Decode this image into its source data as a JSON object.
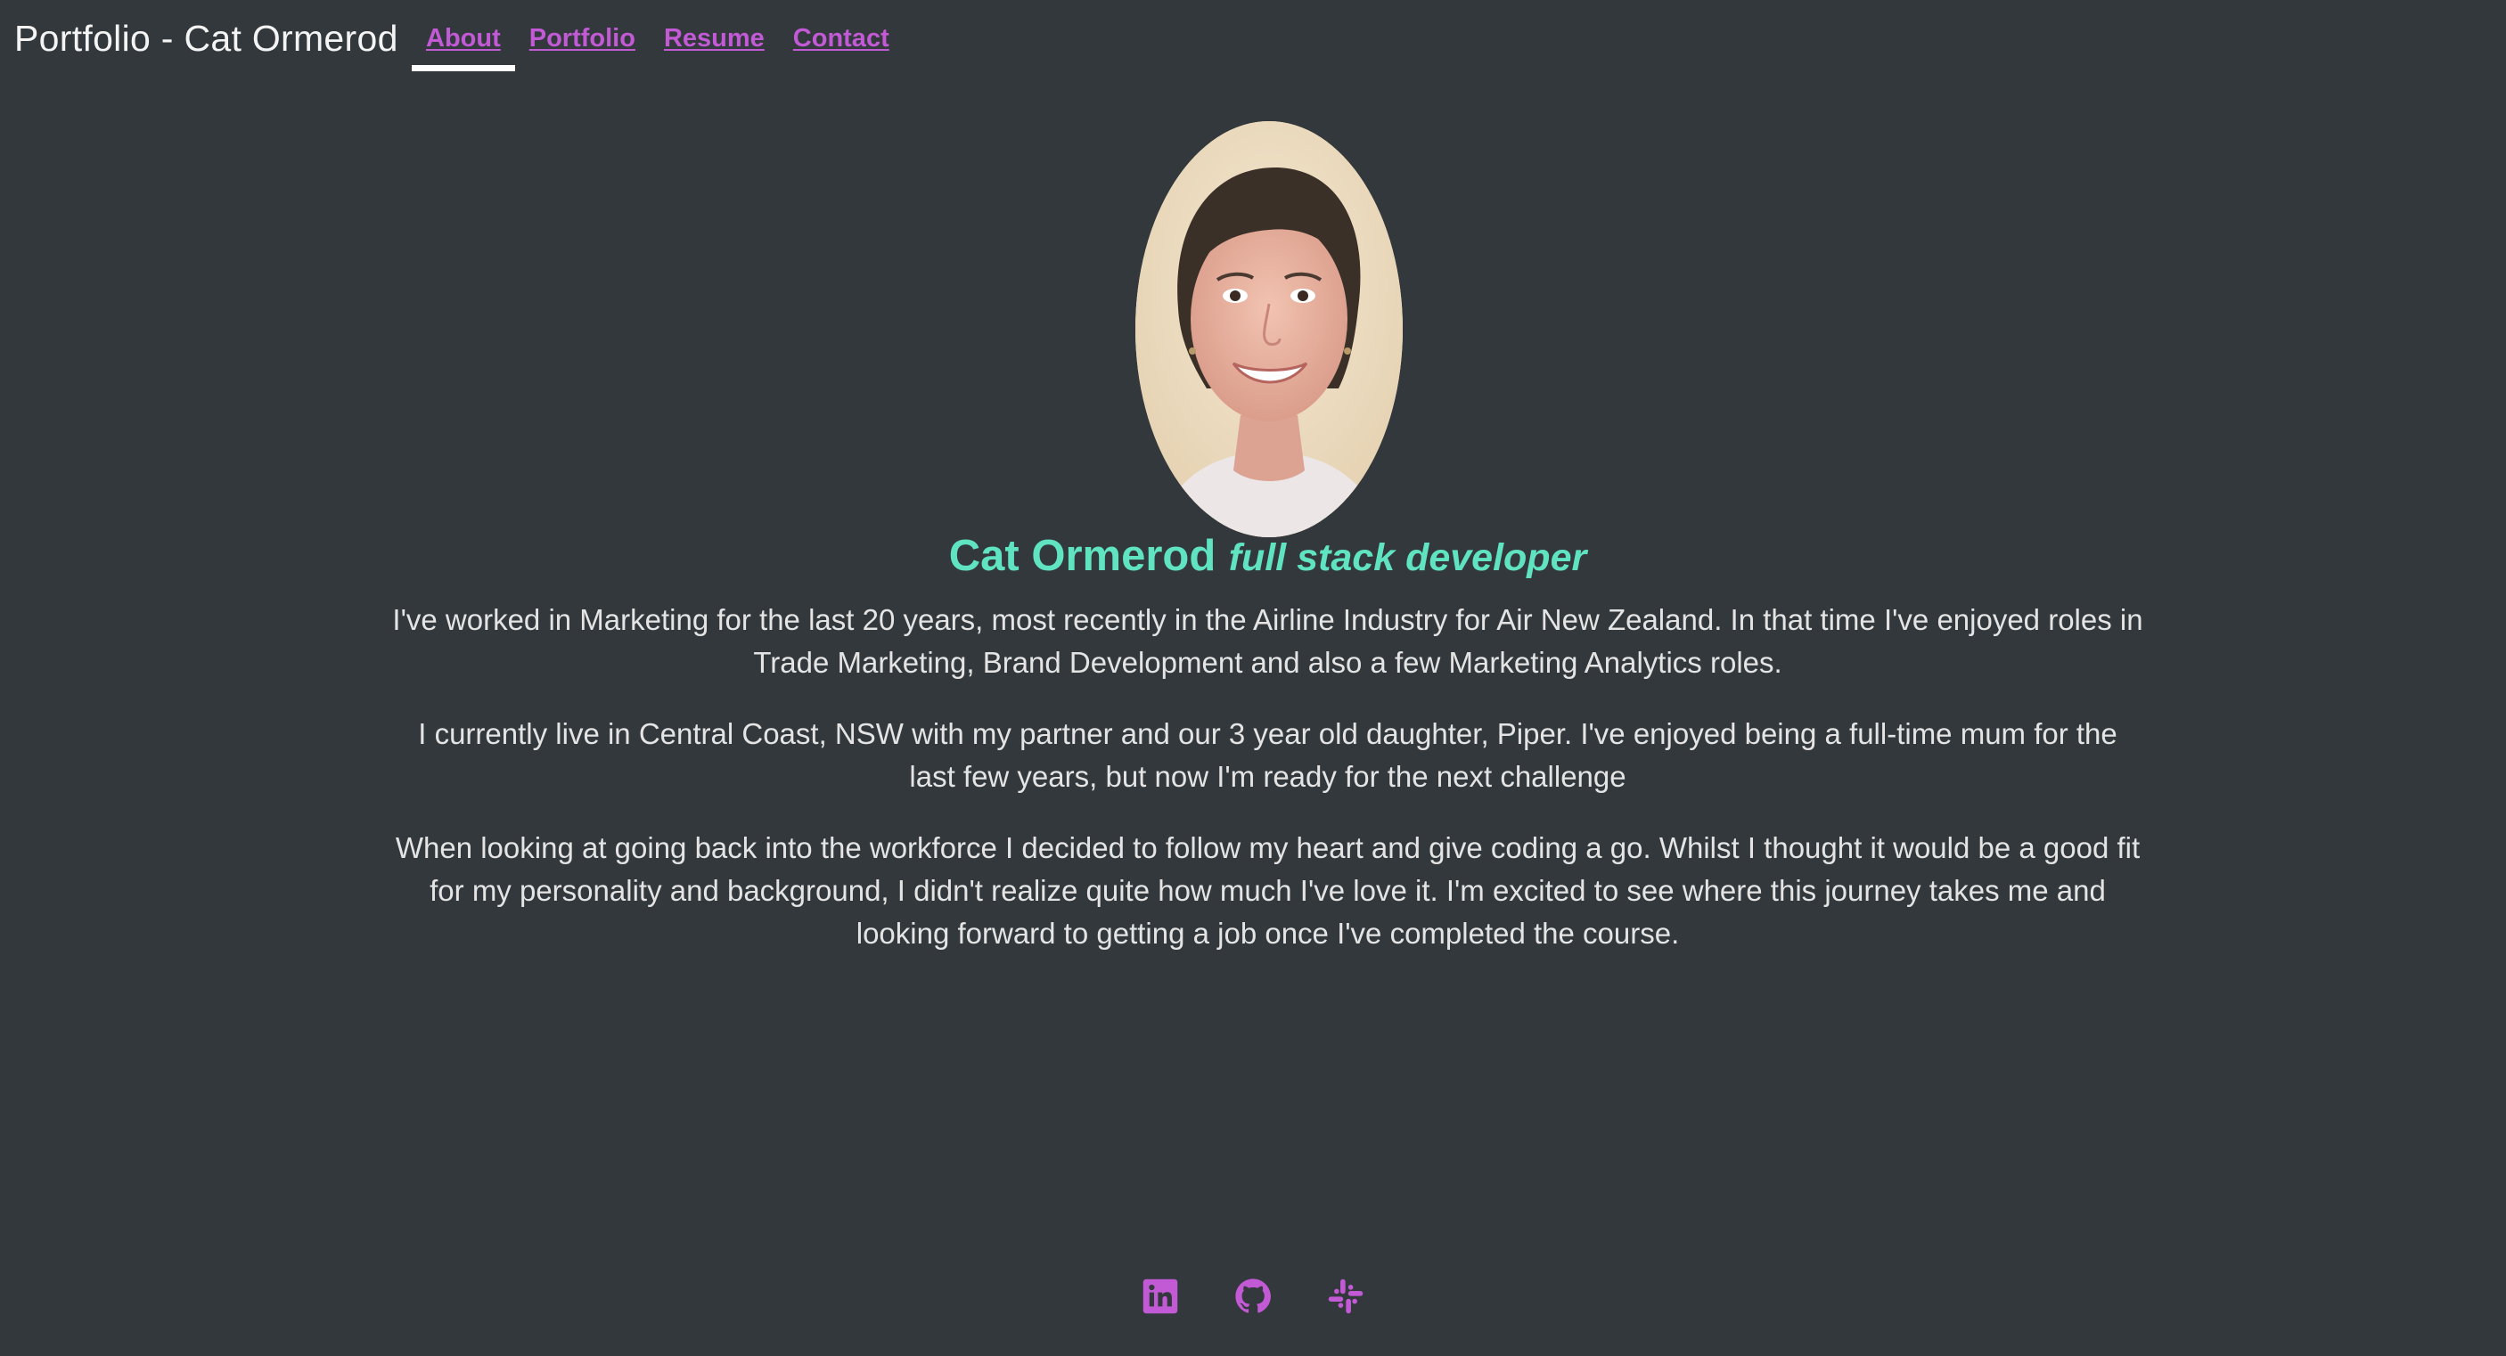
{
  "header": {
    "site_title": "Portfolio - Cat Ormerod",
    "nav": [
      {
        "label": "About",
        "active": true
      },
      {
        "label": "Portfolio",
        "active": false
      },
      {
        "label": "Resume",
        "active": false
      },
      {
        "label": "Contact",
        "active": false
      }
    ]
  },
  "profile": {
    "photo_icon": "profile-photo",
    "name": "Cat Ormerod",
    "role": "full stack developer"
  },
  "bio": [
    "I've worked in Marketing for the last 20 years, most recently in the Airline Industry for Air New Zealand. In that time I've enjoyed roles in Trade Marketing, Brand Development and also a few Marketing Analytics roles.",
    "I currently live in Central Coast, NSW with my partner and our 3 year old daughter, Piper. I've enjoyed being a full-time mum for the last few years, but now I'm ready for the next challenge",
    "When looking at going back into the workforce I decided to follow my heart and give coding a go. Whilst I thought it would be a good fit for my personality and background, I didn't realize quite how much I've love it. I'm excited to see where this journey takes me and looking forward to getting a job once I've completed the course."
  ],
  "footer": {
    "icons": [
      "linkedin-icon",
      "github-icon",
      "slack-icon"
    ]
  },
  "colors": {
    "background": "#33383c",
    "accent_link": "#c25ad6",
    "accent_heading": "#5fe3c0",
    "text": "#e4e4e4"
  }
}
